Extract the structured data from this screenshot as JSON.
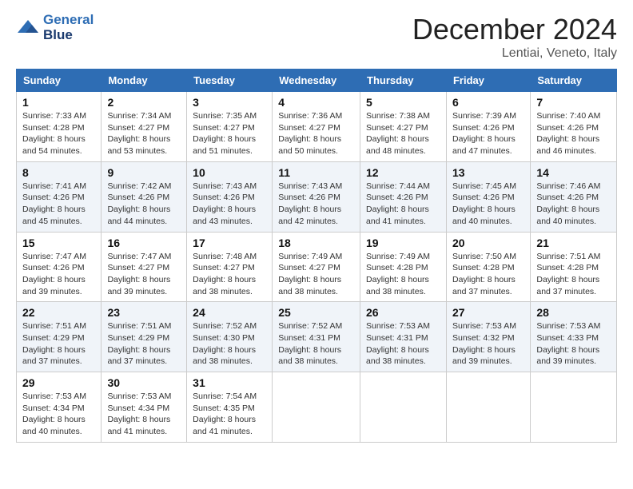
{
  "header": {
    "logo_line1": "General",
    "logo_line2": "Blue",
    "month_title": "December 2024",
    "location": "Lentiai, Veneto, Italy"
  },
  "days_of_week": [
    "Sunday",
    "Monday",
    "Tuesday",
    "Wednesday",
    "Thursday",
    "Friday",
    "Saturday"
  ],
  "weeks": [
    [
      {
        "day": "1",
        "sunrise": "7:33 AM",
        "sunset": "4:28 PM",
        "daylight": "8 hours and 54 minutes."
      },
      {
        "day": "2",
        "sunrise": "7:34 AM",
        "sunset": "4:27 PM",
        "daylight": "8 hours and 53 minutes."
      },
      {
        "day": "3",
        "sunrise": "7:35 AM",
        "sunset": "4:27 PM",
        "daylight": "8 hours and 51 minutes."
      },
      {
        "day": "4",
        "sunrise": "7:36 AM",
        "sunset": "4:27 PM",
        "daylight": "8 hours and 50 minutes."
      },
      {
        "day": "5",
        "sunrise": "7:38 AM",
        "sunset": "4:27 PM",
        "daylight": "8 hours and 48 minutes."
      },
      {
        "day": "6",
        "sunrise": "7:39 AM",
        "sunset": "4:26 PM",
        "daylight": "8 hours and 47 minutes."
      },
      {
        "day": "7",
        "sunrise": "7:40 AM",
        "sunset": "4:26 PM",
        "daylight": "8 hours and 46 minutes."
      }
    ],
    [
      {
        "day": "8",
        "sunrise": "7:41 AM",
        "sunset": "4:26 PM",
        "daylight": "8 hours and 45 minutes."
      },
      {
        "day": "9",
        "sunrise": "7:42 AM",
        "sunset": "4:26 PM",
        "daylight": "8 hours and 44 minutes."
      },
      {
        "day": "10",
        "sunrise": "7:43 AM",
        "sunset": "4:26 PM",
        "daylight": "8 hours and 43 minutes."
      },
      {
        "day": "11",
        "sunrise": "7:43 AM",
        "sunset": "4:26 PM",
        "daylight": "8 hours and 42 minutes."
      },
      {
        "day": "12",
        "sunrise": "7:44 AM",
        "sunset": "4:26 PM",
        "daylight": "8 hours and 41 minutes."
      },
      {
        "day": "13",
        "sunrise": "7:45 AM",
        "sunset": "4:26 PM",
        "daylight": "8 hours and 40 minutes."
      },
      {
        "day": "14",
        "sunrise": "7:46 AM",
        "sunset": "4:26 PM",
        "daylight": "8 hours and 40 minutes."
      }
    ],
    [
      {
        "day": "15",
        "sunrise": "7:47 AM",
        "sunset": "4:26 PM",
        "daylight": "8 hours and 39 minutes."
      },
      {
        "day": "16",
        "sunrise": "7:47 AM",
        "sunset": "4:27 PM",
        "daylight": "8 hours and 39 minutes."
      },
      {
        "day": "17",
        "sunrise": "7:48 AM",
        "sunset": "4:27 PM",
        "daylight": "8 hours and 38 minutes."
      },
      {
        "day": "18",
        "sunrise": "7:49 AM",
        "sunset": "4:27 PM",
        "daylight": "8 hours and 38 minutes."
      },
      {
        "day": "19",
        "sunrise": "7:49 AM",
        "sunset": "4:28 PM",
        "daylight": "8 hours and 38 minutes."
      },
      {
        "day": "20",
        "sunrise": "7:50 AM",
        "sunset": "4:28 PM",
        "daylight": "8 hours and 37 minutes."
      },
      {
        "day": "21",
        "sunrise": "7:51 AM",
        "sunset": "4:28 PM",
        "daylight": "8 hours and 37 minutes."
      }
    ],
    [
      {
        "day": "22",
        "sunrise": "7:51 AM",
        "sunset": "4:29 PM",
        "daylight": "8 hours and 37 minutes."
      },
      {
        "day": "23",
        "sunrise": "7:51 AM",
        "sunset": "4:29 PM",
        "daylight": "8 hours and 37 minutes."
      },
      {
        "day": "24",
        "sunrise": "7:52 AM",
        "sunset": "4:30 PM",
        "daylight": "8 hours and 38 minutes."
      },
      {
        "day": "25",
        "sunrise": "7:52 AM",
        "sunset": "4:31 PM",
        "daylight": "8 hours and 38 minutes."
      },
      {
        "day": "26",
        "sunrise": "7:53 AM",
        "sunset": "4:31 PM",
        "daylight": "8 hours and 38 minutes."
      },
      {
        "day": "27",
        "sunrise": "7:53 AM",
        "sunset": "4:32 PM",
        "daylight": "8 hours and 39 minutes."
      },
      {
        "day": "28",
        "sunrise": "7:53 AM",
        "sunset": "4:33 PM",
        "daylight": "8 hours and 39 minutes."
      }
    ],
    [
      {
        "day": "29",
        "sunrise": "7:53 AM",
        "sunset": "4:34 PM",
        "daylight": "8 hours and 40 minutes."
      },
      {
        "day": "30",
        "sunrise": "7:53 AM",
        "sunset": "4:34 PM",
        "daylight": "8 hours and 41 minutes."
      },
      {
        "day": "31",
        "sunrise": "7:54 AM",
        "sunset": "4:35 PM",
        "daylight": "8 hours and 41 minutes."
      },
      null,
      null,
      null,
      null
    ]
  ],
  "labels": {
    "sunrise_prefix": "Sunrise: ",
    "sunset_prefix": "Sunset: ",
    "daylight_prefix": "Daylight: "
  }
}
